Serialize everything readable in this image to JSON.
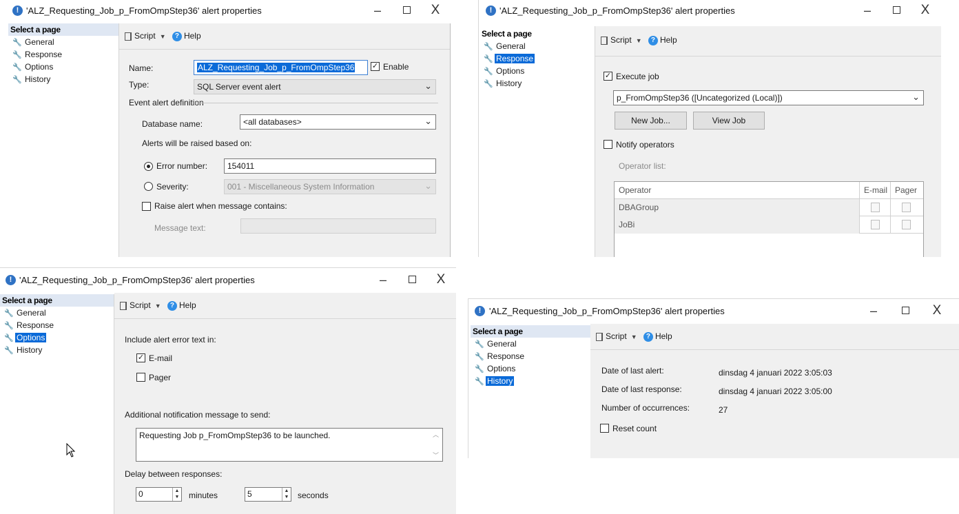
{
  "title": "'ALZ_Requesting_Job_p_FromOmpStep36' alert properties",
  "window_controls": {
    "minimize": "–",
    "maximize": "☐",
    "close": "X"
  },
  "sidebar": {
    "header": "Select a page",
    "items": [
      "General",
      "Response",
      "Options",
      "History"
    ]
  },
  "toolbar": {
    "script_label": "Script",
    "help_label": "Help"
  },
  "general": {
    "name_label": "Name:",
    "name_value": "ALZ_Requesting_Job_p_FromOmpStep36",
    "enable_label": "Enable",
    "type_label": "Type:",
    "type_value": "SQL Server event alert",
    "definition_label": "Event alert definition",
    "database_label": "Database name:",
    "database_value": "<all databases>",
    "raised_label": "Alerts will be raised based on:",
    "error_label": "Error number:",
    "error_value": "154011",
    "severity_label": "Severity:",
    "severity_value": "001 - Miscellaneous System Information",
    "raise_label": "Raise alert when message contains:",
    "message_label": "Message text:"
  },
  "response": {
    "execute_label": "Execute job",
    "job_value": "p_FromOmpStep36 ([Uncategorized (Local)])",
    "new_job_label": "New Job...",
    "view_job_label": "View Job",
    "notify_label": "Notify operators",
    "operator_list_label": "Operator list:",
    "columns": [
      "Operator",
      "E-mail",
      "Pager"
    ],
    "operators": [
      "DBAGroup",
      "JoBi"
    ]
  },
  "options": {
    "include_label": "Include alert error text in:",
    "email_label": "E-mail",
    "pager_label": "Pager",
    "additional_label": "Additional notification message to send:",
    "message_value": "Requesting Job p_FromOmpStep36 to be launched.",
    "delay_label": "Delay between responses:",
    "minutes_value": "0",
    "minutes_label": "minutes",
    "seconds_value": "5",
    "seconds_label": "seconds"
  },
  "history": {
    "last_alert_label": "Date of last alert:",
    "last_alert_value": "dinsdag 4 januari 2022 3:05:03",
    "last_response_label": "Date of last response:",
    "last_response_value": "dinsdag 4 januari 2022 3:05:00",
    "occurrences_label": "Number of occurrences:",
    "occurrences_value": "27",
    "reset_label": "Reset count"
  },
  "icons": [
    "alert-icon",
    "wrench-icon",
    "script-icon",
    "dropdown-arrow-icon",
    "help-icon",
    "chevron-down-icon",
    "checkmark-icon",
    "mouse-cursor-icon"
  ]
}
